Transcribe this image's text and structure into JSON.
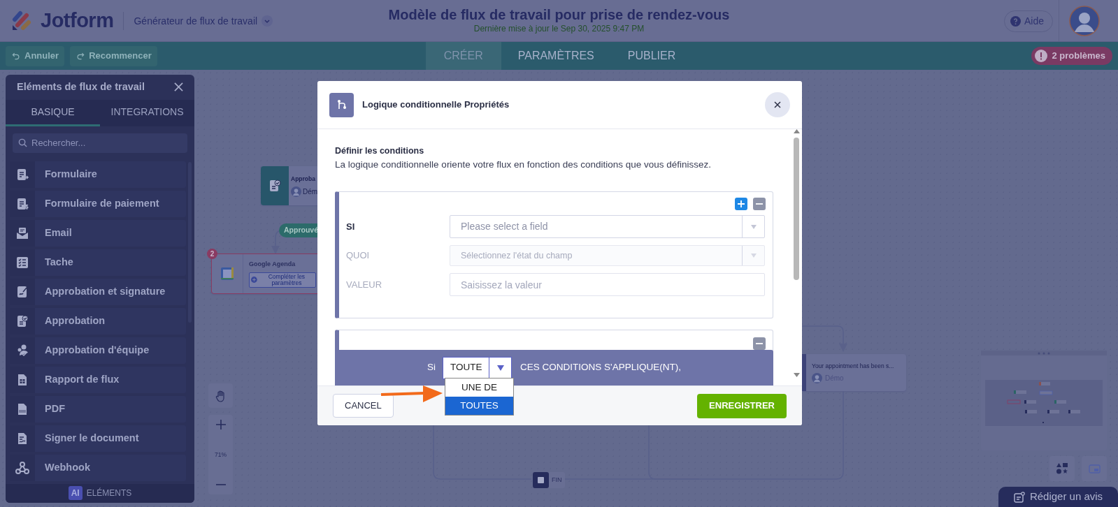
{
  "header": {
    "logo": "Jotform",
    "app_menu": "Générateur de flux de travail",
    "title": "Modèle de flux de travail pour prise de rendez-vous",
    "subtitle": "Dernière mise à jour le Sep 30, 2025 9:47 PM",
    "help_button": "Aide"
  },
  "toolbar": {
    "undo": {
      "label": "Annuler",
      "disabled": true
    },
    "redo": {
      "label": "Recommencer",
      "disabled": true
    },
    "tabs": [
      {
        "label": "CRÉER",
        "selected": true
      },
      {
        "label": "PARAMÈTRES",
        "selected": false
      },
      {
        "label": "PUBLIER",
        "selected": false
      }
    ],
    "issues": "2 problèmes"
  },
  "sidebar": {
    "title": "Eléments de flux de travail",
    "tabs": [
      {
        "label": "BASIQUE",
        "selected": true
      },
      {
        "label": "INTEGRATIONS",
        "selected": false
      }
    ],
    "search": {
      "placeholder": "Rechercher..."
    },
    "items": [
      {
        "label": "Formulaire",
        "kind": "form"
      },
      {
        "label": "Formulaire de paiement",
        "kind": "payment"
      },
      {
        "label": "Email",
        "kind": "email"
      },
      {
        "label": "Tache",
        "kind": "task"
      },
      {
        "label": "Approbation et signature",
        "kind": "approval-signature"
      },
      {
        "label": "Approbation",
        "kind": "approval"
      },
      {
        "label": "Approbation d'équipe",
        "kind": "team"
      },
      {
        "label": "Rapport de flux",
        "kind": "report"
      },
      {
        "label": "PDF",
        "kind": "pdf"
      },
      {
        "label": "Signer le document",
        "kind": "sign"
      },
      {
        "label": "Webhook",
        "kind": "webhook"
      }
    ],
    "ai_badge": "AI",
    "ai_label": "ELÉMENTS"
  },
  "canvas": {
    "nodes": [
      {
        "kind": "approval",
        "title": "Approba",
        "owner": "Dém"
      },
      {
        "kind": "label",
        "text": "Approuvé"
      },
      {
        "kind": "integration",
        "title": "Google Agenda",
        "badge": "2",
        "action": "Compléter les paramètres",
        "error": true
      },
      {
        "kind": "email",
        "title": "Your appointment has been s...",
        "owner": "Démo"
      },
      {
        "kind": "end",
        "title": "FIN"
      }
    ],
    "zoom": "71%",
    "review_button": "Rédiger un avis"
  },
  "modal": {
    "title": "Logique conditionnelle Propriétés",
    "section_title": "Définir les conditions",
    "description": "La logique conditionnelle oriente votre flux en fonction des conditions que vous définissez.",
    "condition": {
      "rows": [
        {
          "label": "SI",
          "kind": "select",
          "placeholder": "Please select a field",
          "disabled": false
        },
        {
          "label": "QUOI",
          "kind": "select",
          "placeholder": "Sélectionnez l'état du champ",
          "disabled": true
        },
        {
          "label": "VALEUR",
          "kind": "input",
          "placeholder": "Saisissez la valeur",
          "disabled": true
        }
      ]
    },
    "match": {
      "prefix": "Si",
      "value": "TOUTE",
      "suffix": "CES CONDITIONS S'APPLIQUE(NT),",
      "options": [
        {
          "label": "UNE DE",
          "selected": false
        },
        {
          "label": "TOUTES",
          "selected": true
        }
      ]
    },
    "cancel": "CANCEL",
    "save": "ENREGISTRER"
  }
}
